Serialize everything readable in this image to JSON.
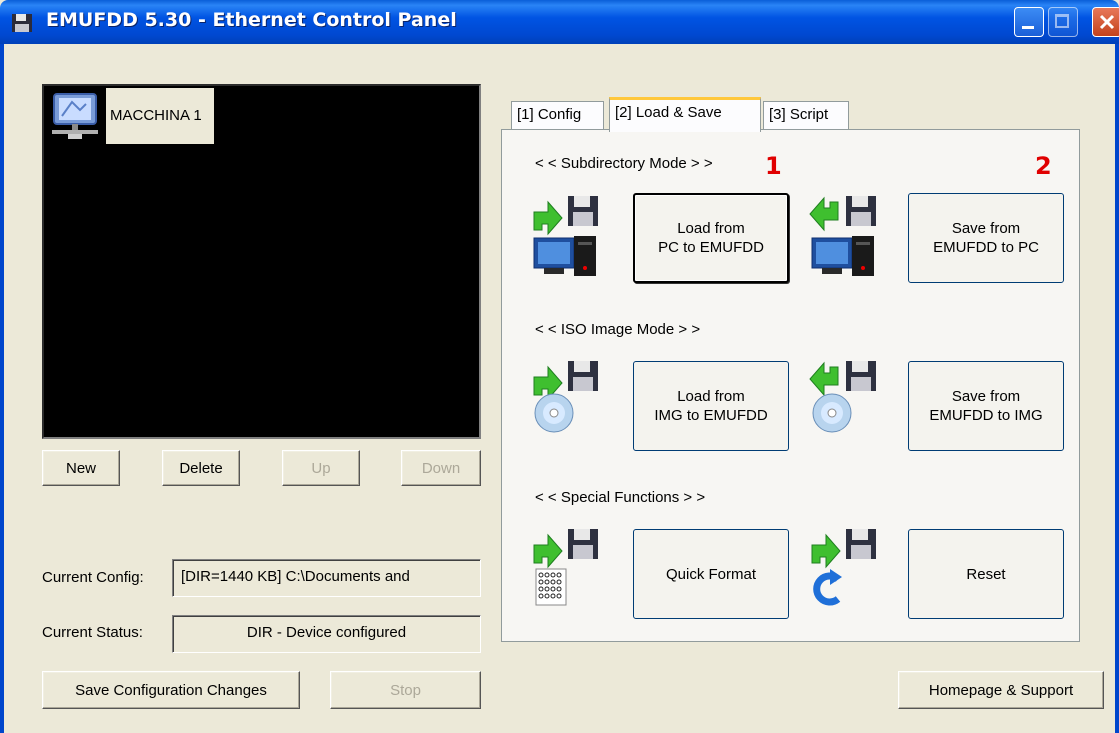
{
  "window": {
    "title": "EMUFDD 5.30 - Ethernet Control Panel",
    "controls": {
      "minimize_icon": "minimize-icon",
      "maximize_icon": "maximize-icon",
      "close_icon": "close-icon"
    }
  },
  "device_list": {
    "items": [
      {
        "label": "MACCHINA 1",
        "icon": "network-computer-icon"
      }
    ],
    "buttons": {
      "new": "New",
      "delete": "Delete",
      "up": "Up",
      "down": "Down"
    }
  },
  "status": {
    "config_label": "Current Config:",
    "config_value": "[DIR=1440 KB] C:\\Documents and",
    "status_label": "Current Status:",
    "status_value": "DIR - Device configured"
  },
  "bottom_buttons": {
    "save_config": "Save Configuration Changes",
    "stop": "Stop",
    "homepage": "Homepage & Support"
  },
  "tabs": [
    {
      "label": "[1] Config"
    },
    {
      "label": "[2] Load & Save"
    },
    {
      "label": "[3] Script"
    }
  ],
  "active_tab": "[2] Load & Save",
  "load_save": {
    "subdirectory_mode": {
      "heading": "< < Subdirectory Mode > >",
      "load_button": "Load from\nPC to EMUFDD",
      "save_button": "Save from\nEMUFDD to PC"
    },
    "iso_mode": {
      "heading": "< < ISO Image Mode > >",
      "load_button": "Load from\nIMG to EMUFDD",
      "save_button": "Save from\nEMUFDD to IMG"
    },
    "special_functions": {
      "heading": "< < Special Functions > >",
      "format_button": "Quick Format",
      "reset_button": "Reset"
    }
  },
  "annotations": {
    "marker_1": "1",
    "marker_2": "2"
  },
  "colors": {
    "titlebar": "#0054e3",
    "marker": "#e00000",
    "list_background": "#000000",
    "window_background": "#ece9d8"
  }
}
